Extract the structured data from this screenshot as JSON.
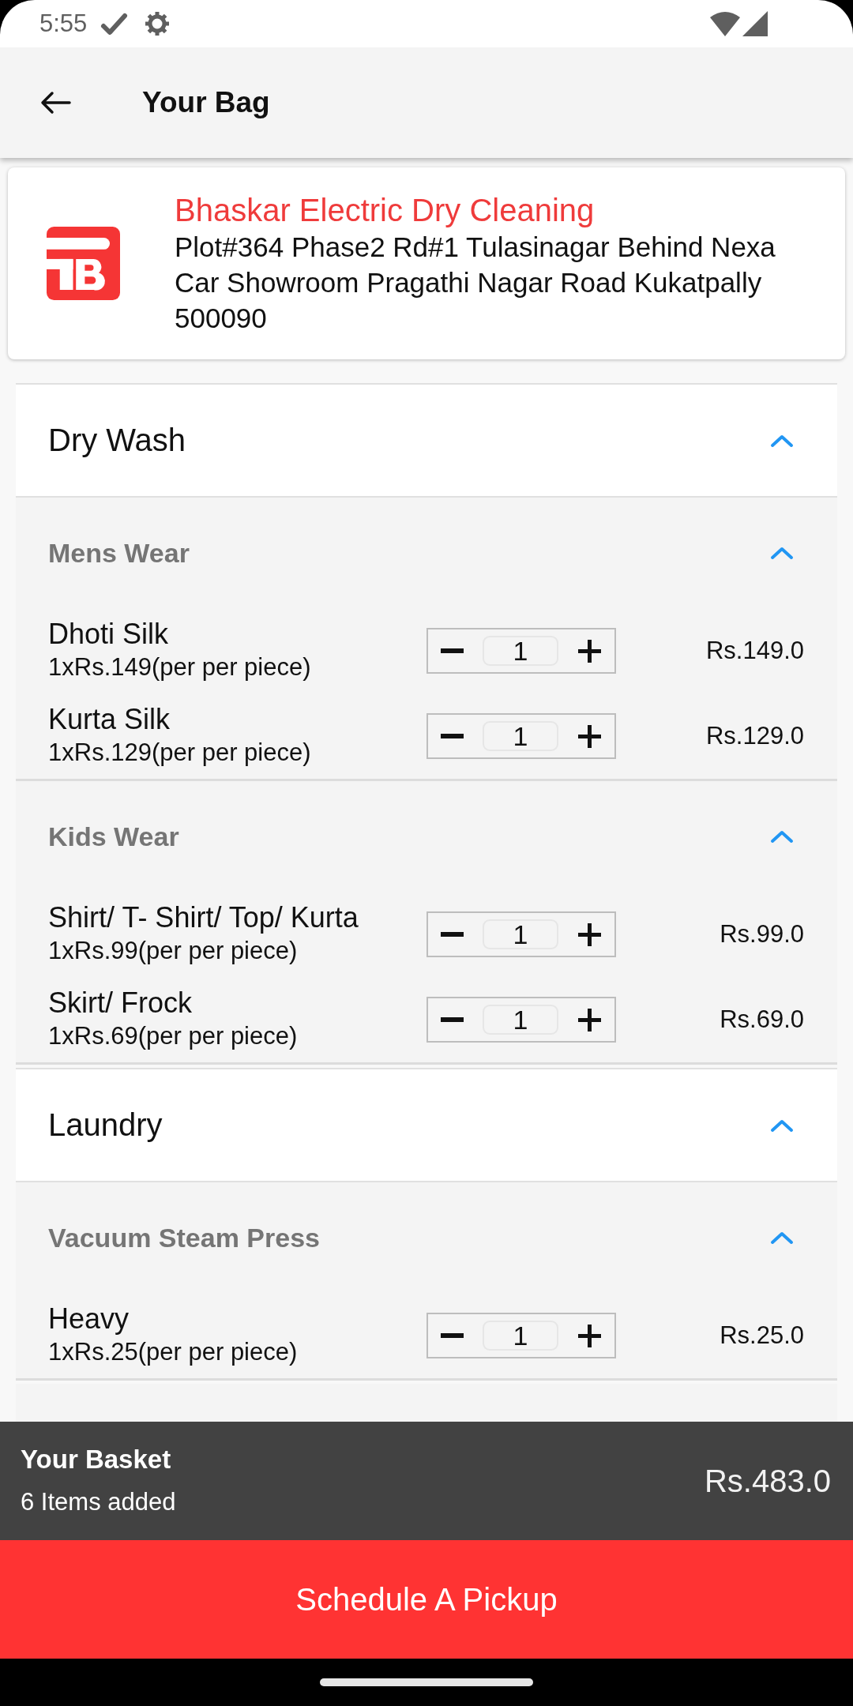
{
  "status_bar": {
    "time": "5:55"
  },
  "app_bar": {
    "title": "Your Bag"
  },
  "shop": {
    "name": "Bhaskar Electric Dry Cleaning",
    "address": "Plot#364 Phase2 Rd#1 Tulasinagar Behind Nexa Car Showroom Pragathi Nagar Road Kukatpally 500090"
  },
  "services": [
    {
      "name": "Dry Wash",
      "expanded": true,
      "categories": [
        {
          "name": "Mens Wear",
          "expanded": true,
          "items": [
            {
              "name": "Dhoti Silk",
              "rate": "1xRs.149(per per piece)",
              "quantity": "1",
              "total": "Rs.149.0"
            },
            {
              "name": "Kurta Silk",
              "rate": "1xRs.129(per per piece)",
              "quantity": "1",
              "total": "Rs.129.0"
            }
          ]
        },
        {
          "name": "Kids Wear",
          "expanded": true,
          "items": [
            {
              "name": "Shirt/ T- Shirt/ Top/ Kurta",
              "rate": "1xRs.99(per per piece)",
              "quantity": "1",
              "total": "Rs.99.0"
            },
            {
              "name": "Skirt/ Frock",
              "rate": "1xRs.69(per per piece)",
              "quantity": "1",
              "total": "Rs.69.0"
            }
          ]
        }
      ]
    },
    {
      "name": "Laundry",
      "expanded": true,
      "categories": [
        {
          "name": "Vacuum Steam Press",
          "expanded": true,
          "items": [
            {
              "name": "Heavy",
              "rate": "1xRs.25(per per piece)",
              "quantity": "1",
              "total": "Rs.25.0"
            }
          ]
        }
      ]
    }
  ],
  "basket": {
    "title": "Your Basket",
    "items_added": "6 Items added",
    "total": "Rs.483.0"
  },
  "pickup_button": {
    "label": "Schedule A Pickup"
  }
}
